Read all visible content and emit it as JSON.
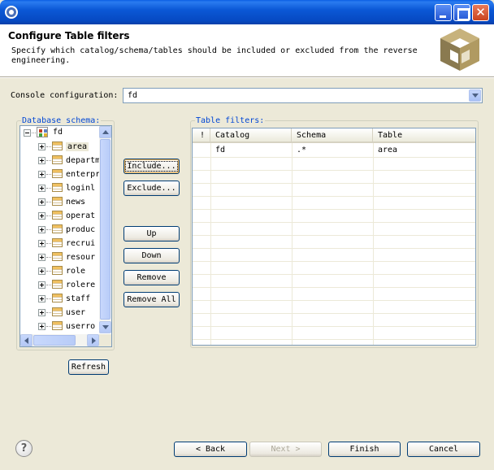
{
  "window": {
    "title": "",
    "icon": "eclipse-gear-icon",
    "accent": "#0b58d6"
  },
  "header": {
    "title": "Configure Table filters",
    "description": "Specify which catalog/schema/tables should be included or excluded from the reverse engineering.",
    "banner_icon": "hibernate-cube-icon"
  },
  "console": {
    "label": "Console configuration:",
    "value": "fd"
  },
  "database_schema": {
    "label": "Database schema:",
    "root": "fd",
    "tables": [
      "area",
      "departm",
      "enterpr",
      "loginl",
      "news",
      "operat",
      "produc",
      "recrui",
      "resour",
      "role",
      "rolere",
      "staff",
      "user",
      "userro"
    ],
    "selected": "area"
  },
  "actions": {
    "include": "Include...",
    "exclude": "Exclude...",
    "up": "Up",
    "down": "Down",
    "remove": "Remove",
    "remove_all": "Remove All",
    "refresh": "Refresh"
  },
  "table_filters": {
    "label": "Table filters:",
    "columns": [
      "!",
      "Catalog",
      "Schema",
      "Table"
    ],
    "rows": [
      {
        "excluded": "",
        "catalog": "fd",
        "schema": ".*",
        "table": "area"
      }
    ]
  },
  "footer": {
    "back": "< Back",
    "next": "Next >",
    "finish": "Finish",
    "cancel": "Cancel"
  }
}
